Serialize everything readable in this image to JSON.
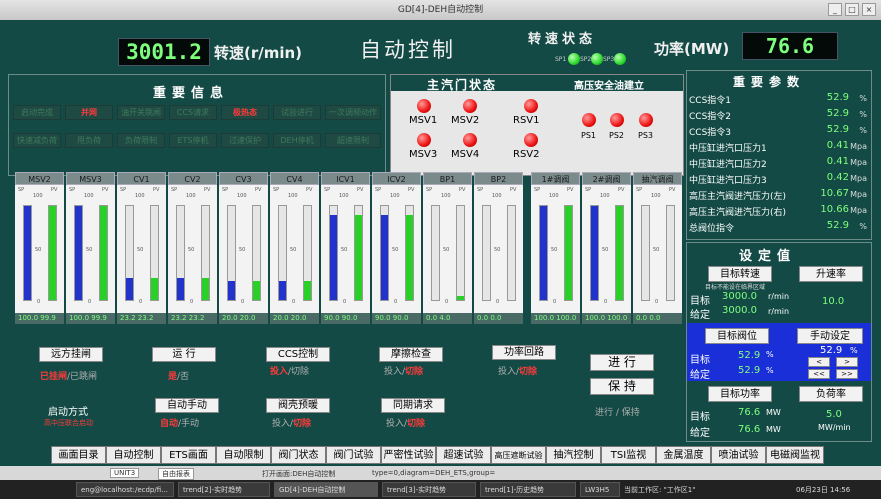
{
  "window": {
    "title": "GD[4]-DEH自动控制",
    "btn_min": "_",
    "btn_max": "□",
    "btn_close": "×"
  },
  "header": {
    "speed_value": "3001.2",
    "speed_label": "转速(r/min)",
    "page_title": "自动控制",
    "speed_status_title": "转速状态",
    "led_labels": [
      "SP1",
      "SP2",
      "SP3"
    ],
    "power_label": "功率(MW)",
    "power_value": "76.6"
  },
  "info": {
    "title": "重要信息",
    "cells": [
      {
        "label": "启动完成",
        "red": false
      },
      {
        "label": "并网",
        "red": true
      },
      {
        "label": "油开关跳闸",
        "red": false
      },
      {
        "label": "CCS请求",
        "red": false
      },
      {
        "label": "极热态",
        "red": true
      },
      {
        "label": "试验进行",
        "red": false
      },
      {
        "label": "一次调频动作",
        "red": false
      },
      {
        "label": "快速减负荷",
        "red": false
      },
      {
        "label": "甩负荷",
        "red": false
      },
      {
        "label": "负荷限制",
        "red": false
      },
      {
        "label": "ETS停机",
        "red": false
      },
      {
        "label": "过速保护",
        "red": false
      },
      {
        "label": "DEH停机",
        "red": false
      },
      {
        "label": "超速限制",
        "red": false
      }
    ]
  },
  "valve_status": {
    "title": "主汽门状态",
    "labels": [
      "MSV1",
      "MSV2",
      "RSV1",
      "MSV3",
      "MSV4",
      "RSV2"
    ],
    "oil_title": "高压安全油建立",
    "ps_labels": [
      "PS1",
      "PS2",
      "PS3"
    ]
  },
  "params": {
    "title": "重要参数",
    "rows": [
      {
        "label": "CCS指令1",
        "value": "52.9",
        "unit": "%"
      },
      {
        "label": "CCS指令2",
        "value": "52.9",
        "unit": "%"
      },
      {
        "label": "CCS指令3",
        "value": "52.9",
        "unit": "%"
      },
      {
        "label": "中压缸进汽口压力1",
        "value": "0.41",
        "unit": "Mpa"
      },
      {
        "label": "中压缸进汽口压力2",
        "value": "0.41",
        "unit": "Mpa"
      },
      {
        "label": "中压缸进汽口压力3",
        "value": "0.42",
        "unit": "Mpa"
      },
      {
        "label": "高压主汽阀进汽压力(左)",
        "value": "10.67",
        "unit": "Mpa"
      },
      {
        "label": "高压主汽阀进汽压力(右)",
        "value": "10.66",
        "unit": "Mpa"
      },
      {
        "label": "总阀位指令",
        "value": "52.9",
        "unit": "%"
      }
    ]
  },
  "valve_bars": {
    "sp_label": "SP",
    "pv_label": "PV",
    "scale_top": "100",
    "scale_mid": "50",
    "scale_bot": "0",
    "bars": [
      {
        "name": "MSV2",
        "sp": 100,
        "pv": 100,
        "foot": "100.0 99.9"
      },
      {
        "name": "MSV3",
        "sp": 100,
        "pv": 100,
        "foot": "100.0 99.9"
      },
      {
        "name": "CV1",
        "sp": 23,
        "pv": 23,
        "foot": "23.2 23.2"
      },
      {
        "name": "CV2",
        "sp": 23,
        "pv": 23,
        "foot": "23.2 23.2"
      },
      {
        "name": "CV3",
        "sp": 20,
        "pv": 20,
        "foot": "20.0 20.0"
      },
      {
        "name": "CV4",
        "sp": 20,
        "pv": 20,
        "foot": "20.0 20.0"
      },
      {
        "name": "ICV1",
        "sp": 90,
        "pv": 90,
        "foot": "90.0 90.0"
      },
      {
        "name": "ICV2",
        "sp": 90,
        "pv": 90,
        "foot": "90.0 90.0"
      },
      {
        "name": "BP1",
        "sp": 0,
        "pv": 4,
        "foot": "0.0 4.0"
      },
      {
        "name": "BP2",
        "sp": 0,
        "pv": 0,
        "foot": "0.0 0.0"
      },
      {
        "name": "1#调阀",
        "sp": 100,
        "pv": 100,
        "foot": "100.0 100.0"
      },
      {
        "name": "2#调阀",
        "sp": 100,
        "pv": 100,
        "foot": "100.0 100.0"
      },
      {
        "name": "抽汽调阀",
        "sp": 0,
        "pv": 0,
        "foot": "0.0 0.0"
      }
    ]
  },
  "controls": {
    "remote_btn": "远方挂闸",
    "remote_on": "已挂闸",
    "remote_off": "/已跳闸",
    "run_btn": "运 行",
    "run_on": "是",
    "run_off": "/否",
    "ccs_btn": "CCS控制",
    "ccs_on": "投入",
    "ccs_off": "/切除",
    "rub_btn": "摩擦检查",
    "rub_on": "投入/",
    "rub_off": "切除",
    "power_loop_btn": "功率回路",
    "pl_on": "投入/",
    "pl_off": "切除",
    "run2_btn": "进 行",
    "hold_btn": "保 持",
    "run_hold": "进行 / 保持",
    "start_mode_label": "启动方式",
    "start_mode_value": "高中压联合启动",
    "auto_btn": "自动手动",
    "auto_on": "自动",
    "auto_off": "/手动",
    "preheat_btn": "阀壳预暖",
    "ph_on": "投入/",
    "ph_off": "切除",
    "sync_btn": "同期请求",
    "sy_on": "投入/",
    "sy_off": "切除"
  },
  "setpoints": {
    "title": "设定值",
    "target_speed_btn": "目标转速",
    "ramp_btn": "升速率",
    "hint": "目标不能设在临界区域",
    "target_label": "目标",
    "target_speed": "3000.0",
    "speed_unit": "r/min",
    "given_label": "给定",
    "given_speed": "3000.0",
    "ramp_value": "10.0",
    "valve_btn": "目标阀位",
    "manual_btn": "手动设定",
    "valve_target": "52.9",
    "valve_given": "52.9",
    "pct": "%",
    "manual_value": "52.9",
    "arrow_l": "<",
    "arrow_r": ">",
    "arrow_ll": "<<",
    "arrow_rr": ">>",
    "power_btn": "目标功率",
    "load_rate_btn": "负荷率",
    "power_target": "76.6",
    "power_given": "76.6",
    "mw": "MW",
    "load_rate": "5.0",
    "load_rate_unit": "MW/min"
  },
  "nav": [
    "画面目录",
    "自动控制",
    "ETS画面",
    "自动限制",
    "阀门状态",
    "阀门试验",
    "严密性试验",
    "超速试验",
    "高压遮断试验",
    "抽汽控制",
    "TSI监视",
    "金属温度",
    "喷油试验",
    "电磁阀监视"
  ],
  "statusbar": {
    "unit": "UNIT3",
    "mode": "自由报表",
    "msg": "打开画面:DEH自动控制",
    "path": "type=0,diagram=DEH_ETS,group="
  },
  "taskbar": {
    "tasks": [
      "eng@localhost:/ecdp/fi...",
      "trend[2]-实时趋势",
      "GD[4]-DEH自动控制",
      "trend[3]-实时趋势",
      "trend[1]-历史趋势",
      "LW3H5"
    ],
    "workspace": "当前工作区: \"工作区1\"",
    "clock": "06月23日 14:56"
  }
}
